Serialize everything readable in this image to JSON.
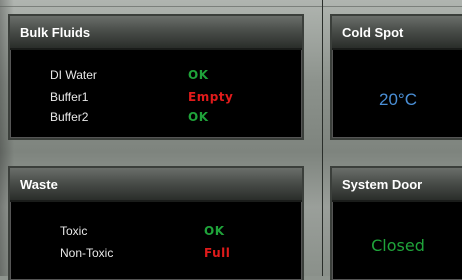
{
  "colors": {
    "ok": "#1fa33a",
    "alert": "#e01b1b",
    "temperature": "#4a8fd6"
  },
  "bulk_fluids": {
    "title": "Bulk Fluids",
    "items": [
      {
        "label": "DI Water",
        "status": "OK"
      },
      {
        "label": "Buffer1",
        "status": "Empty"
      },
      {
        "label": "Buffer2",
        "status": "OK"
      }
    ]
  },
  "cold_spot": {
    "title": "Cold Spot",
    "value": "20°C"
  },
  "waste": {
    "title": "Waste",
    "items": [
      {
        "label": "Toxic",
        "status": "OK"
      },
      {
        "label": "Non-Toxic",
        "status": "Full"
      }
    ]
  },
  "system_door": {
    "title": "System Door",
    "value": "Closed"
  }
}
